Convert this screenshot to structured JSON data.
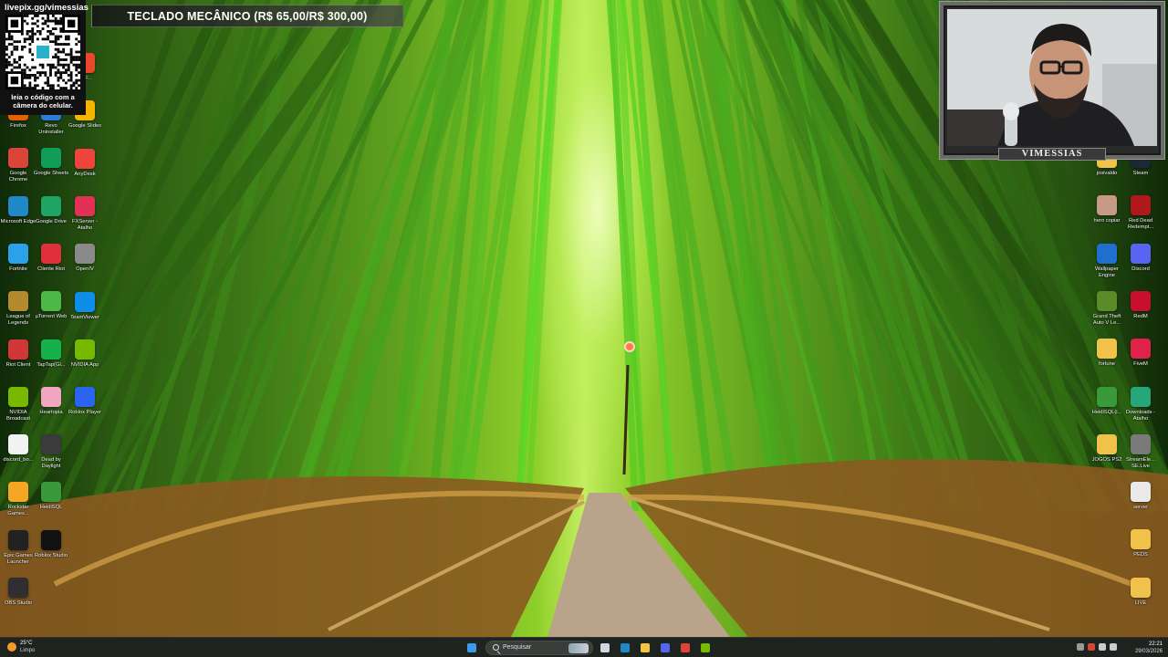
{
  "overlay": {
    "qr_url": "livepix.gg/vimessias",
    "qr_hint": "leia o código com a câmera do celular.",
    "goal_banner": "TECLADO MECÂNICO (R$ 65,00/R$ 300,00)",
    "webcam_name": "VIMESSIAS"
  },
  "desktop_left": {
    "col1": [
      {
        "label": "Firefox",
        "color": "#e66000"
      },
      {
        "label": "Google Chrome",
        "color": "#db4437"
      },
      {
        "label": "Microsoft Edge",
        "color": "#1e88c8"
      },
      {
        "label": "Fortnite",
        "color": "#2aa1e8"
      },
      {
        "label": "League of Legends",
        "color": "#b38b2d"
      },
      {
        "label": "Riot Client",
        "color": "#d13639"
      },
      {
        "label": "NVIDIA Broadcast",
        "color": "#76b900"
      },
      {
        "label": "discord_bo...",
        "color": "#f2f2f2"
      },
      {
        "label": "Rockstar Games...",
        "color": "#f5a623"
      },
      {
        "label": "Epic Games Launcher",
        "color": "#222222"
      },
      {
        "label": "OBS Studio",
        "color": "#302e31"
      }
    ],
    "col2": [
      {
        "label": "Revo Uninstaller",
        "color": "#2d7bd6"
      },
      {
        "label": "Google Sheets",
        "color": "#0f9d58"
      },
      {
        "label": "Google Drive",
        "color": "#1fa463"
      },
      {
        "label": "Cliente Riot",
        "color": "#e0313b"
      },
      {
        "label": "µTorrent Web",
        "color": "#4cb848"
      },
      {
        "label": "TapTap(Gl...",
        "color": "#17b14b"
      },
      {
        "label": "Heartopia",
        "color": "#f2a6c2"
      },
      {
        "label": "Dead by Daylight",
        "color": "#3b3b3b"
      },
      {
        "label": "HeidiSQL",
        "color": "#3a9a3a"
      },
      {
        "label": "Roblox Studio",
        "color": "#111111"
      }
    ],
    "col3": [
      {
        "label": "PDF...",
        "color": "#e8472b"
      },
      {
        "label": "Google Slides",
        "color": "#f4b400"
      },
      {
        "label": "AnyDesk",
        "color": "#ef443b"
      },
      {
        "label": "FXServer - Atalho",
        "color": "#e23154"
      },
      {
        "label": "OpenIV",
        "color": "#8a8a8a"
      },
      {
        "label": "TeamViewer",
        "color": "#0e8ee9"
      },
      {
        "label": "NVIDIA App",
        "color": "#76b900"
      },
      {
        "label": "Roblox Player",
        "color": "#2a64f0"
      }
    ]
  },
  "desktop_right": {
    "col1": [
      {
        "label": "josivaldo",
        "color": "#f0c24a"
      },
      {
        "label": "hero copiar",
        "color": "#c79a86"
      },
      {
        "label": "Wallpaper Engine",
        "color": "#1f6fd1"
      },
      {
        "label": "Grand Theft Auto V Le...",
        "color": "#5a8a2a"
      },
      {
        "label": "fortune",
        "color": "#f0c24a"
      },
      {
        "label": "HeidiSQL(i...",
        "color": "#3a9a3a"
      },
      {
        "label": "JOGOS PS2",
        "color": "#f0c24a"
      }
    ],
    "col2": [
      {
        "label": "Steam",
        "color": "#1b2838"
      },
      {
        "label": "Red Dead Redempt...",
        "color": "#b0191c"
      },
      {
        "label": "Discord",
        "color": "#5865f2"
      },
      {
        "label": "RedM",
        "color": "#c8102e"
      },
      {
        "label": "FiveM",
        "color": "#e0214a"
      },
      {
        "label": "Downloads - Atalho",
        "color": "#27a67a"
      },
      {
        "label": "StreamEle... SE.Live",
        "color": "#7a7a7a"
      },
      {
        "label": "server",
        "color": "#e9e9e9"
      },
      {
        "label": "PEDS",
        "color": "#f0c24a"
      },
      {
        "label": "LIVE",
        "color": "#f0c24a"
      }
    ]
  },
  "taskbar": {
    "weather_temp": "25°C",
    "weather_cond": "Limpo",
    "search_placeholder": "Pesquisar",
    "time": "22:21",
    "date": "29/03/2026",
    "pinned": [
      {
        "name": "task-view",
        "color": "#cfd8dc"
      },
      {
        "name": "edge",
        "color": "#1e88c8"
      },
      {
        "name": "file-explorer",
        "color": "#f3c63f"
      },
      {
        "name": "discord",
        "color": "#5865f2"
      },
      {
        "name": "chrome",
        "color": "#db4437"
      },
      {
        "name": "nvidia",
        "color": "#76b900"
      }
    ]
  }
}
